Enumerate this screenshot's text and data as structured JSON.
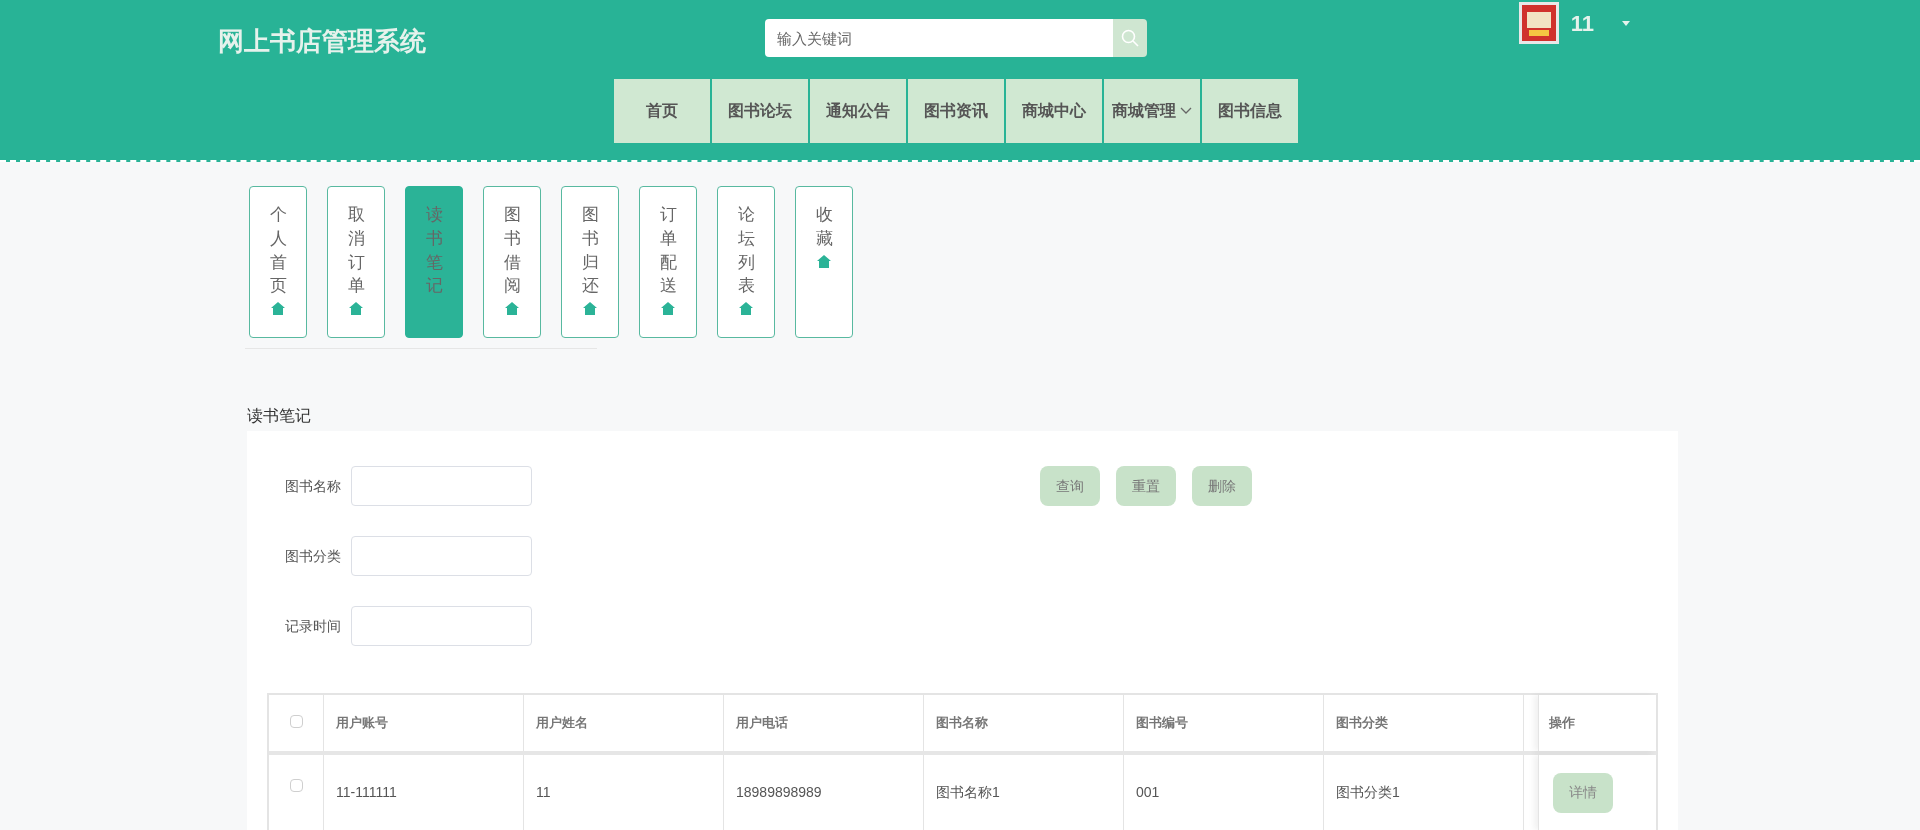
{
  "header": {
    "title": "网上书店管理系统",
    "search": {
      "placeholder": "输入关键词"
    },
    "user": {
      "name": "11"
    }
  },
  "nav": [
    {
      "label": "首页",
      "dropdown": false
    },
    {
      "label": "图书论坛",
      "dropdown": false
    },
    {
      "label": "通知公告",
      "dropdown": false
    },
    {
      "label": "图书资讯",
      "dropdown": false
    },
    {
      "label": "商城中心",
      "dropdown": false
    },
    {
      "label": "商城管理",
      "dropdown": true
    },
    {
      "label": "图书信息",
      "dropdown": false
    }
  ],
  "side_tabs": [
    {
      "label": "个人首页",
      "selected": false
    },
    {
      "label": "取消订单",
      "selected": false
    },
    {
      "label": "读书笔记",
      "selected": true
    },
    {
      "label": "图书借阅",
      "selected": false
    },
    {
      "label": "图书归还",
      "selected": false
    },
    {
      "label": "订单配送",
      "selected": false
    },
    {
      "label": "论坛列表",
      "selected": false
    },
    {
      "label": "收藏",
      "selected": false
    }
  ],
  "section_title": "读书笔记",
  "filters": [
    {
      "label": "图书名称"
    },
    {
      "label": "图书分类"
    },
    {
      "label": "记录时间"
    }
  ],
  "buttons": [
    "查询",
    "重置",
    "删除"
  ],
  "table": {
    "columns": [
      "用户账号",
      "用户姓名",
      "用户电话",
      "图书名称",
      "图书编号",
      "图书分类"
    ],
    "action_column": "操作",
    "rows": [
      {
        "checked": false,
        "cells": [
          "11-111111",
          "11",
          "18989898989",
          "图书名称1",
          "001",
          "图书分类1"
        ],
        "action": "详情"
      }
    ],
    "header_checked": false
  }
}
